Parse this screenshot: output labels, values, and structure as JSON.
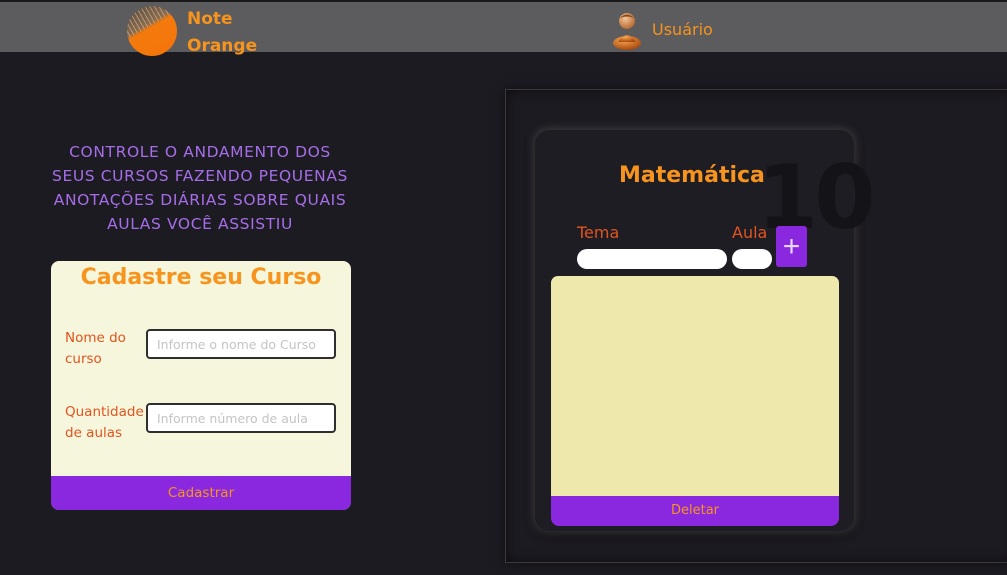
{
  "header": {
    "logo_line1": "Note",
    "logo_line2": "Orange",
    "user_label": "Usuário"
  },
  "slogan": "CONTROLE O ANDAMENTO DOS SEUS CURSOS FAZENDO PEQUENAS ANOTAÇÕES DIÁRIAS SOBRE QUAIS AULAS VOCÊ ASSISTIU",
  "register": {
    "title": "Cadastre seu Curso",
    "name_label": "Nome do curso",
    "name_placeholder": "Informe o nome do Curso",
    "name_value": "",
    "qty_label": "Quantidade de aulas",
    "qty_placeholder": "Informe número de aula",
    "qty_value": "",
    "submit_label": "Cadastrar"
  },
  "course": {
    "title": "Matemática",
    "lesson_count": "10",
    "tema_label": "Tema",
    "aula_label": "Aula",
    "add_label": "+",
    "delete_label": "Deletar"
  },
  "colors": {
    "accent_orange": "#f7941d",
    "accent_purple": "#8a28e0",
    "label_red": "#e0541f",
    "slogan_purple": "#a56ee8",
    "background": "#1d1b22",
    "header_bg": "#5c5b5e",
    "card_bg": "#f6f6dc",
    "notes_bg": "#efe8ac"
  },
  "icons": {
    "logo": "note-orange-logo-icon",
    "user": "user-avatar-icon",
    "add": "plus-icon"
  }
}
